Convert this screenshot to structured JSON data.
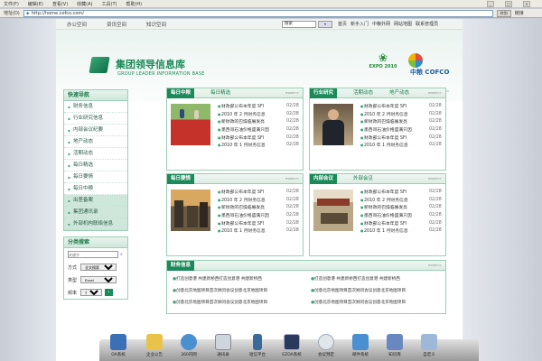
{
  "browser": {
    "menu": [
      "文件(F)",
      "编辑(E)",
      "查看(V)",
      "收藏(A)",
      "工具(T)",
      "帮助(H)"
    ],
    "address_label": "地址(D)",
    "address": "http://home.cofco.com/",
    "go_label": "转到",
    "links_label": "链接"
  },
  "site": {
    "nav": [
      "办公空间",
      "资讯空间",
      "知识空间"
    ],
    "search_placeholder": "搜索",
    "search_button": "搜索",
    "toplinks": [
      "首页",
      "新手入门",
      "中粮外网",
      "网站地图",
      "联系管理员"
    ],
    "logo_title": "集团领导信息库",
    "logo_sub": "GROUP LEADER INFORMATION BASE",
    "expo_label": "EXPO 2010",
    "cofco_label": "中粮 COFCO",
    "expo_sub": "中国2010年上海世博会高级赞助商 Senior Sponsor of Expo 2010 Shanghai China"
  },
  "quicknav": {
    "title": "快速导航",
    "items": [
      "财务信息",
      "行业研究信息",
      "内部会议纪要",
      "地产动态",
      "活期动态",
      "每日精选",
      "每日要情",
      "每日中粮",
      "出差备案",
      "集团通讯录",
      "外部机构联络信息"
    ]
  },
  "search_panel": {
    "title": "分类搜索",
    "placeholder": "关键字",
    "type_label": "方式",
    "type_value": "全文搜索",
    "class_label": "类型",
    "class_value": "Excel",
    "freq_label": "频率",
    "freq_value": "不限"
  },
  "panels": [
    {
      "tabs": [
        "每日中粮",
        "每日精选"
      ],
      "more": "more>>",
      "items": [
        {
          "t": "财政部公布本年度 SFI",
          "d": "02/28"
        },
        {
          "t": "2010 年 2 月财务信息",
          "d": "02/28"
        },
        {
          "t": "新财政的巴燥临展发亮",
          "d": "02/28"
        },
        {
          "t": "墨西哥石油价格盛满只因",
          "d": "02/28"
        },
        {
          "t": "财政部公布本年度 SFI",
          "d": "02/28"
        },
        {
          "t": "2010 年 1 月财务信息",
          "d": "02/28"
        }
      ]
    },
    {
      "tabs": [
        "行业研究",
        "活期动态",
        "地产动态"
      ],
      "more": "more>>",
      "items": [
        {
          "t": "财政部公布本年度 SFI",
          "d": "02/28"
        },
        {
          "t": "2010 年 2 月财务信息",
          "d": "02/28"
        },
        {
          "t": "新财政的巴燥临展发亮",
          "d": "02/28"
        },
        {
          "t": "墨西哥石油价格盛满只因",
          "d": "02/28"
        },
        {
          "t": "财政部公布本年度 SFI",
          "d": "02/28"
        },
        {
          "t": "2010 年 1 月财务信息",
          "d": "02/28"
        }
      ]
    },
    {
      "tabs": [
        "每日要情"
      ],
      "more": "more>>",
      "items": [
        {
          "t": "财政部公布本年度 SFI",
          "d": "02/28"
        },
        {
          "t": "2010 年 2 月财务信息",
          "d": "02/28"
        },
        {
          "t": "新财政的巴燥临展发亮",
          "d": "02/28"
        },
        {
          "t": "墨西哥石油价格盛满只因",
          "d": "02/28"
        },
        {
          "t": "财政部公布本年度 SFI",
          "d": "02/28"
        },
        {
          "t": "2010 年 1 月财务信息",
          "d": "02/28"
        }
      ]
    },
    {
      "tabs": [
        "内部会议",
        "外部会见"
      ],
      "more": "more>>",
      "items": [
        {
          "t": "财政部公布本年度 SFI",
          "d": "02/28"
        },
        {
          "t": "2010 年 2 月财务信息",
          "d": "02/28"
        },
        {
          "t": "新财政的巴燥临展发亮",
          "d": "02/28"
        },
        {
          "t": "墨西哥石油价格盛满只因",
          "d": "02/28"
        },
        {
          "t": "财政部公布本年度 SFI",
          "d": "02/28"
        },
        {
          "t": "2010 年 1 月财务信息",
          "d": "02/28"
        }
      ]
    }
  ],
  "news": {
    "title": "财务信息",
    "more": "more>>",
    "items": [
      "打造创意港 共建新桥西打造创意港 共建新桥西",
      "打造创意港 共建新桥西打造创意港 共建新桥西",
      "创意北京地图项目首次顾问会议创意北京地图项目",
      "创意北京地图项目首次顾问会议创意北京地图项目",
      "创意北京地图项目首次顾问会议创意北京地图项目",
      "创意北京地图项目首次顾问会议创意北京地图项目"
    ]
  },
  "dock": {
    "items": [
      {
        "label": "OA系统",
        "icon": "oa-icon",
        "color": "#3b6fb6"
      },
      {
        "label": "企业公告",
        "icon": "notice-icon",
        "color": "#e8c24a"
      },
      {
        "label": "360内网",
        "icon": "intranet-icon",
        "color": "#4a8fd0"
      },
      {
        "label": "通讯录",
        "icon": "contacts-icon",
        "color": "#d0d4dc"
      },
      {
        "label": "短信平台",
        "icon": "sms-icon",
        "color": "#3a6a9a"
      },
      {
        "label": "EZOA系统",
        "icon": "ezoa-icon",
        "color": "#2a3a5a"
      },
      {
        "label": "会议预定",
        "icon": "meeting-icon",
        "color": "#e0e6ea"
      },
      {
        "label": "邮件系统",
        "icon": "mail-icon",
        "color": "#4a90d0"
      },
      {
        "label": "知识库",
        "icon": "knowledge-icon",
        "color": "#6a88c0"
      },
      {
        "label": "自定义",
        "icon": "custom-icon",
        "color": "#a0b8d8"
      }
    ]
  }
}
